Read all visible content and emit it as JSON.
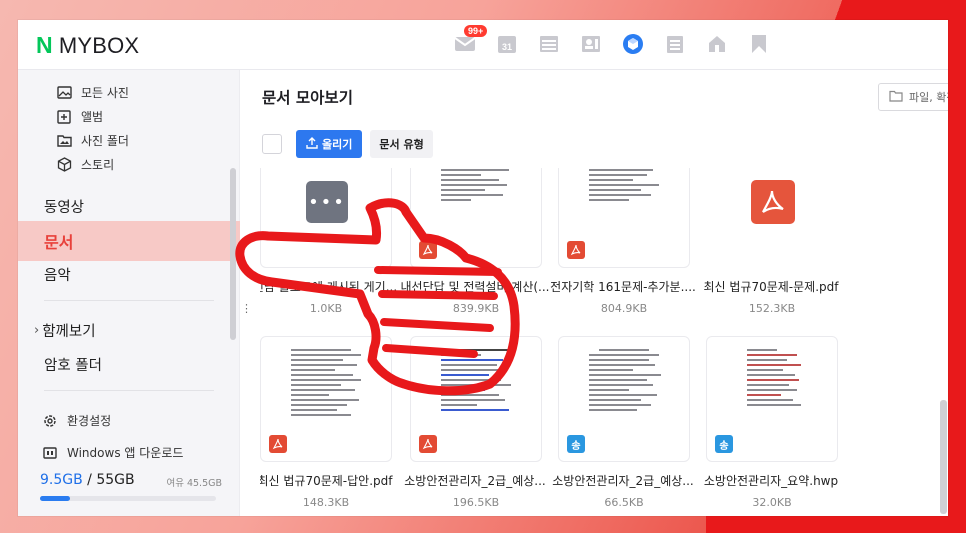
{
  "header": {
    "logo_n": "N",
    "logo_text": "MYBOX",
    "mail_badge": "99+",
    "apps": [
      "mail-icon",
      "calendar-icon",
      "memo-icon",
      "contacts-icon",
      "mybox-icon",
      "todo-icon",
      "home-icon",
      "bookmark-icon"
    ]
  },
  "sidebar": {
    "photo_sub": [
      {
        "label": "모든 사진",
        "icon": "photo-icon"
      },
      {
        "label": "앨범",
        "icon": "album-icon"
      },
      {
        "label": "사진 폴더",
        "icon": "photo-folder-icon"
      },
      {
        "label": "스토리",
        "icon": "story-icon"
      }
    ],
    "video": "동영상",
    "document": "문서",
    "music": "음악",
    "shared": "함께보기",
    "shared_arrow": "›",
    "secret": "암호 폴더",
    "settings": "환경설정",
    "windows": "Windows 앱 다운로드",
    "storage_used": "9.5GB",
    "storage_sep": " / ",
    "storage_total": "55GB",
    "storage_free": "여유 45.5GB",
    "storage_fraction": 0.17
  },
  "main": {
    "title": "문서 모아보기",
    "right_button": "파일, 확장",
    "upload": "올리기",
    "doc_type": "문서 유형",
    "files": [
      {
        "name": "신남 블로그에 게시된 게기...",
        "size": "1.0KB",
        "type": "more"
      },
      {
        "name": "내선단답 및 전력설비 계산(...",
        "size": "839.9KB",
        "type": "pdf"
      },
      {
        "name": "전자기학 161문제-추가분....",
        "size": "804.9KB",
        "type": "pdf"
      },
      {
        "name": "최신 법규70문제-문제.pdf",
        "size": "152.3KB",
        "type": "pdf-big"
      },
      {
        "name": "최신 법규70문제-답안.pdf",
        "size": "148.3KB",
        "type": "pdf"
      },
      {
        "name": "소방안전관리자_2급_예상...",
        "size": "196.5KB",
        "type": "pdf"
      },
      {
        "name": "소방안전관리자_2급_예상...",
        "size": "66.5KB",
        "type": "hwp"
      },
      {
        "name": "소방안전관리자_요약.hwp",
        "size": "32.0KB",
        "type": "hwp"
      }
    ],
    "hwp_letter": "송"
  },
  "colors": {
    "accent": "#2d78ef",
    "brand": "#03c75a",
    "active_bg": "#f7c9c6",
    "active_text": "#e8413b",
    "pdf": "#e34b34",
    "hwp": "#2a97e0"
  }
}
